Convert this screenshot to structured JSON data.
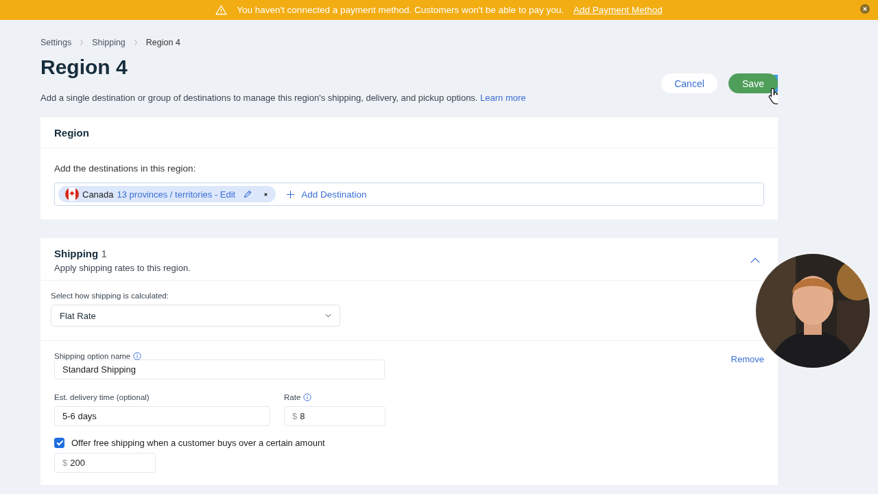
{
  "banner": {
    "message": "You haven't connected a payment method. Customers won't be able to pay you.",
    "link": "Add Payment Method"
  },
  "breadcrumbs": [
    {
      "label": "Settings"
    },
    {
      "label": "Shipping"
    },
    {
      "label": "Region 4"
    }
  ],
  "page": {
    "title": "Region 4",
    "description": "Add a single destination or group of destinations to manage this region's shipping, delivery, and pickup options.",
    "learn_more": "Learn more"
  },
  "actions": {
    "cancel": "Cancel",
    "save": "Save"
  },
  "region": {
    "title": "Region",
    "prompt": "Add the destinations in this region:",
    "destinations": [
      {
        "country": "Canada",
        "detail": "13 provinces / territories - Edit"
      }
    ],
    "add": "Add Destination"
  },
  "shipping": {
    "title": "Shipping",
    "count": "1",
    "subtitle": "Apply shipping rates to this region.",
    "expanded": true,
    "method_label": "Select how shipping is calculated:",
    "method": "Flat Rate",
    "options": [
      {
        "name_label": "Shipping option name",
        "name": "Standard Shipping",
        "remove": "Remove",
        "delivery_label": "Est. delivery time (optional)",
        "delivery": "5-6 days",
        "rate_label": "Rate",
        "currency": "$",
        "rate": "8",
        "free_shipping": {
          "label": "Offer free shipping when a customer buys over a certain amount",
          "checked": true,
          "currency": "$",
          "threshold": "200"
        }
      }
    ]
  }
}
